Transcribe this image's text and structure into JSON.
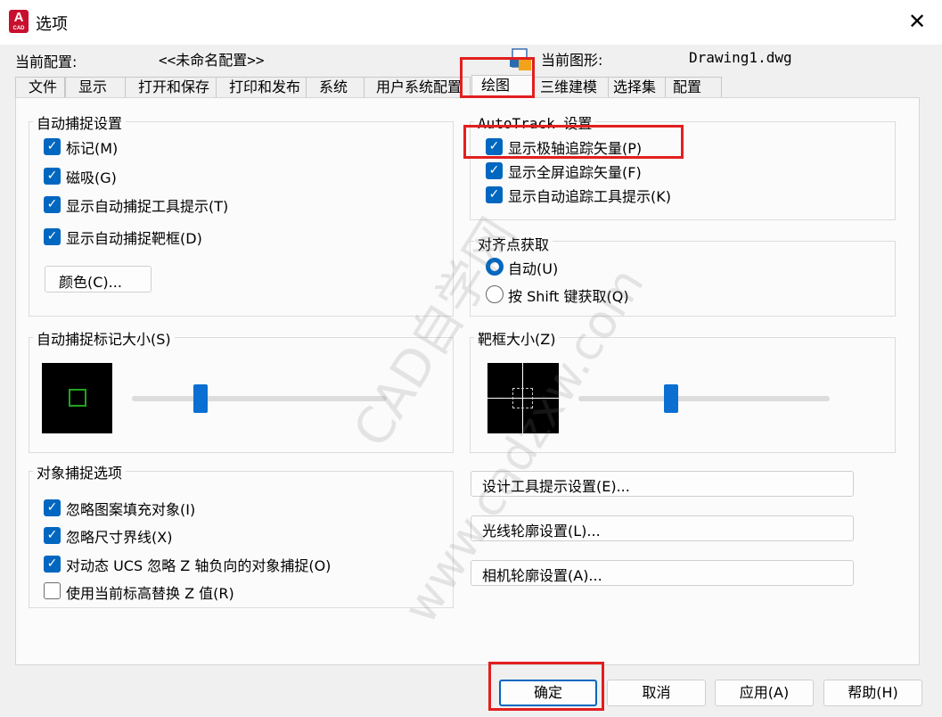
{
  "window": {
    "title": "选项",
    "app_icon_text": "A",
    "app_icon_sub": "CAD",
    "close_glyph": "✕"
  },
  "header": {
    "current_profile_label": "当前配置:",
    "current_profile_value": "<<未命名配置>>",
    "current_drawing_label": "当前图形:",
    "current_drawing_value": "Drawing1.dwg"
  },
  "tabs": [
    "文件",
    "显示",
    "打开和保存",
    "打印和发布",
    "系统",
    "用户系统配置",
    "绘图",
    "三维建模",
    "选择集",
    "配置"
  ],
  "active_tab": "绘图",
  "autosnap": {
    "title": "自动捕捉设置",
    "options": [
      {
        "label": "标记(M)",
        "checked": true
      },
      {
        "label": "磁吸(G)",
        "checked": true
      },
      {
        "label": "显示自动捕捉工具提示(T)",
        "checked": true
      },
      {
        "label": "显示自动捕捉靶框(D)",
        "checked": true
      }
    ],
    "color_button": "颜色(C)..."
  },
  "autotrack": {
    "title": "AutoTrack 设置",
    "options": [
      {
        "label": "显示极轴追踪矢量(P)",
        "checked": true
      },
      {
        "label": "显示全屏追踪矢量(F)",
        "checked": true
      },
      {
        "label": "显示自动追踪工具提示(K)",
        "checked": true
      }
    ]
  },
  "alignment": {
    "title": "对齐点获取",
    "options": [
      {
        "label": "自动(U)",
        "selected": true
      },
      {
        "label": "按 Shift 键获取(Q)",
        "selected": false
      }
    ]
  },
  "marker_size": {
    "title": "自动捕捉标记大小(S)",
    "level": 0.27,
    "marker_color": "#1fa61f"
  },
  "aperture_size": {
    "title": "靶框大小(Z)",
    "level": 0.37
  },
  "object_snap": {
    "title": "对象捕捉选项",
    "options": [
      {
        "label": "忽略图案填充对象(I)",
        "checked": true
      },
      {
        "label": "忽略尺寸界线(X)",
        "checked": true
      },
      {
        "label": "对动态 UCS 忽略 Z 轴负向的对象捕捉(O)",
        "checked": true
      },
      {
        "label": "使用当前标高替换 Z 值(R)",
        "checked": false
      }
    ]
  },
  "side_buttons": [
    "设计工具提示设置(E)...",
    "光线轮廓设置(L)...",
    "相机轮廓设置(A)..."
  ],
  "footer_buttons": {
    "ok": "确定",
    "cancel": "取消",
    "apply": "应用(A)",
    "help": "帮助(H)"
  },
  "watermark": {
    "line1": "CAD自学网",
    "line2": "www.cadzxw.com"
  },
  "colors": {
    "accent": "#0067c0",
    "highlight": "#e21f1f",
    "dialog_bg": "#f0f0f0",
    "panel_bg": "#fbfbfb"
  }
}
